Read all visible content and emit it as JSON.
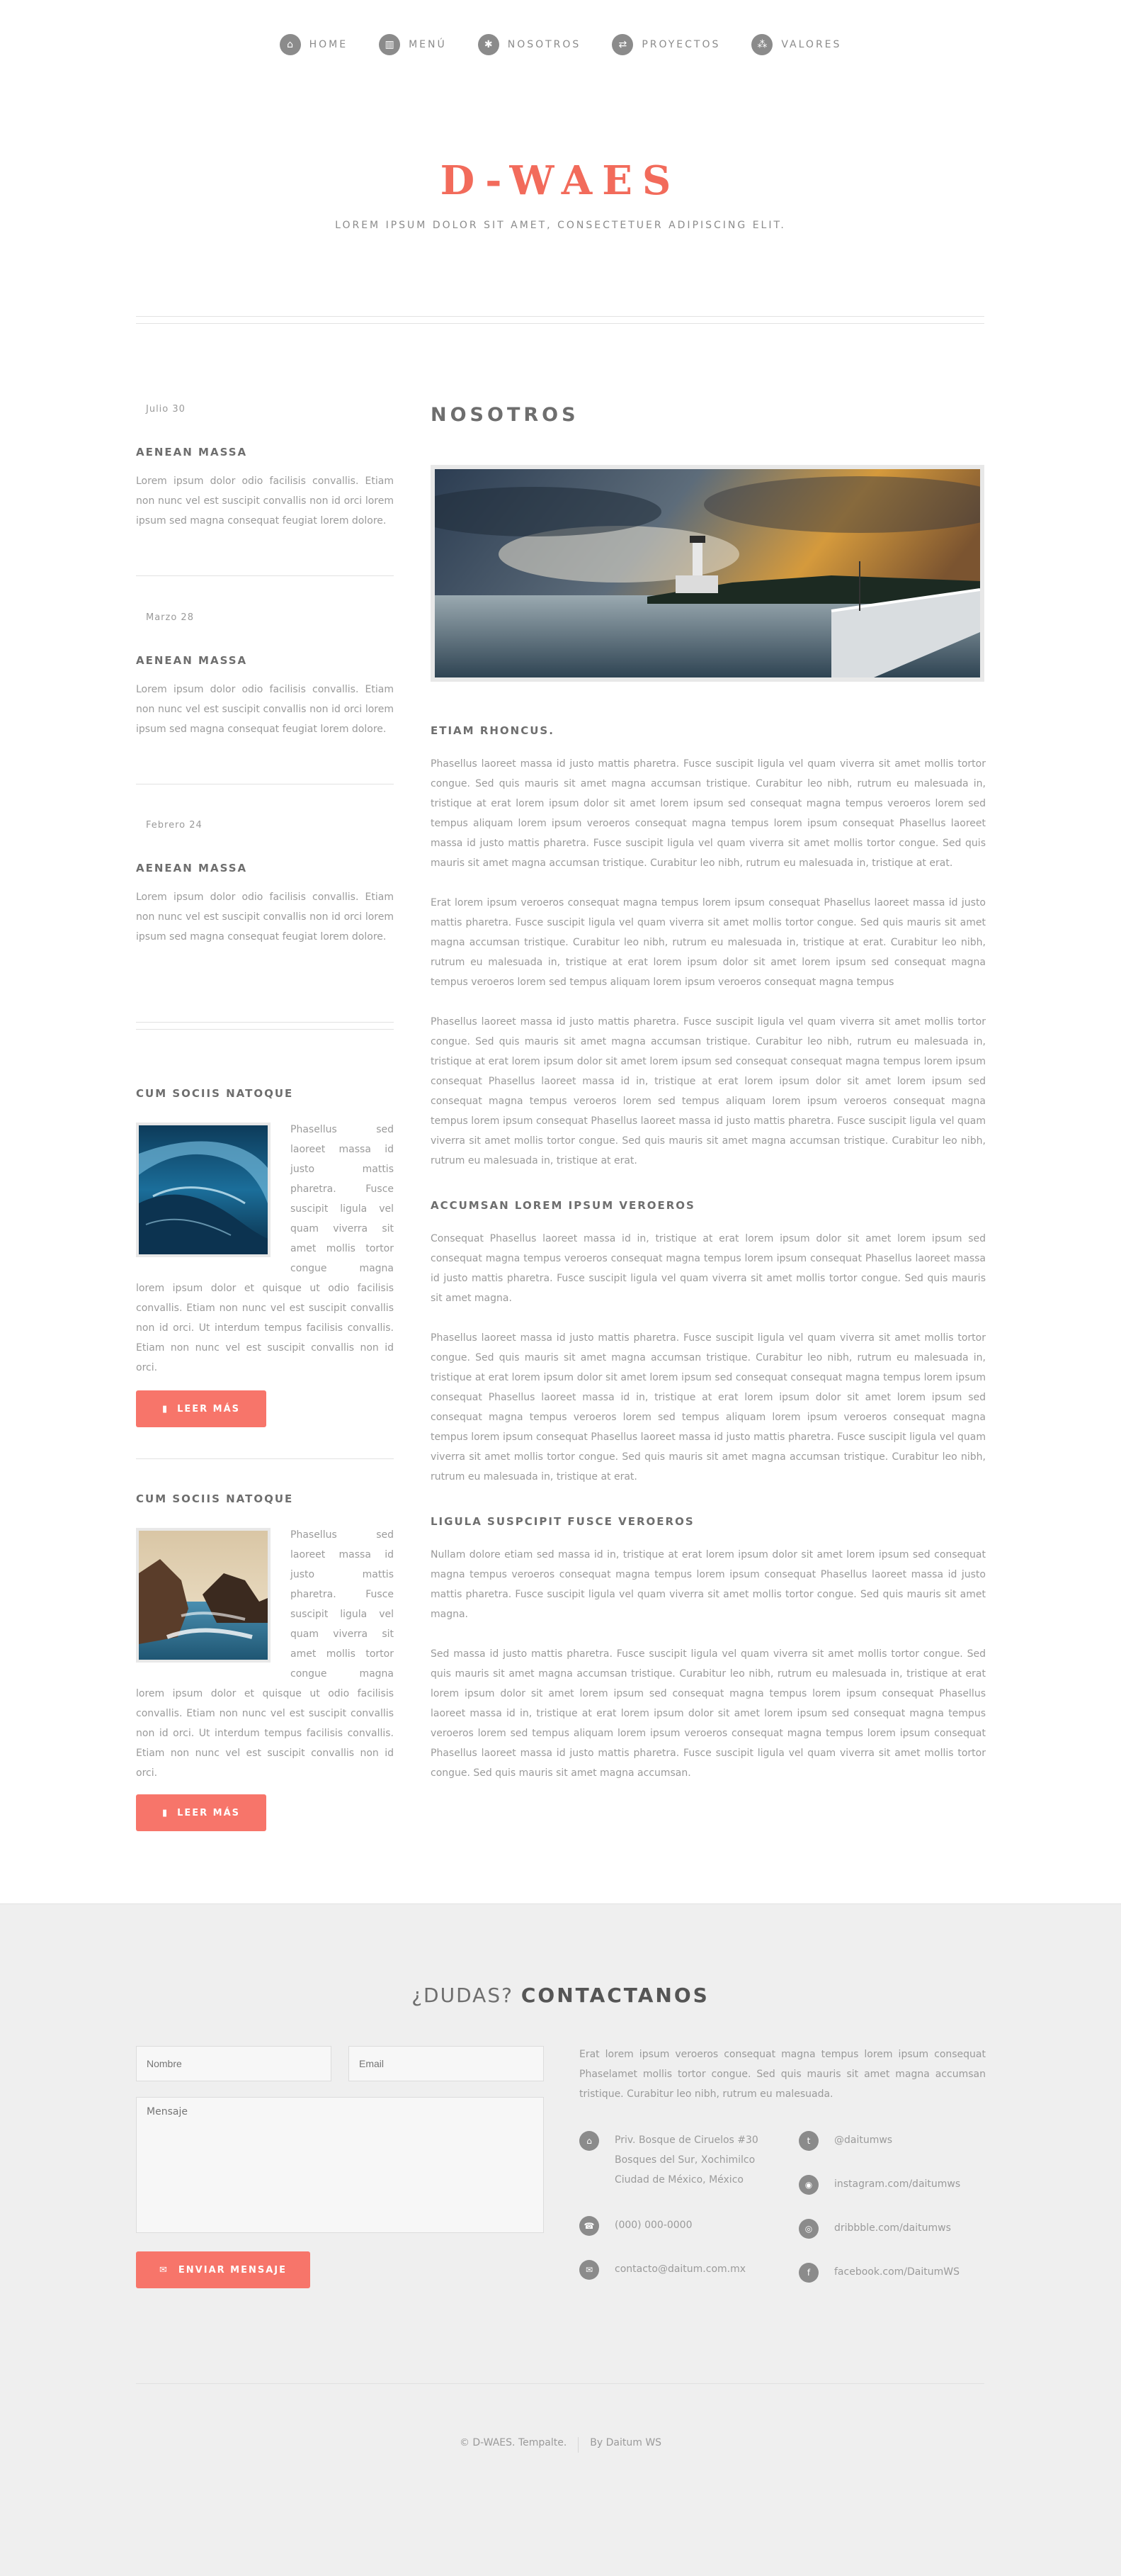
{
  "nav": [
    {
      "icon": "home-icon",
      "glyph": "⌂",
      "label": "HOME"
    },
    {
      "icon": "chart-icon",
      "glyph": "▥",
      "label": "MENÚ"
    },
    {
      "icon": "gear-icon",
      "glyph": "✱",
      "label": "NOSOTROS"
    },
    {
      "icon": "retweet-icon",
      "glyph": "⇄",
      "label": "PROYECTOS"
    },
    {
      "icon": "sitemap-icon",
      "glyph": "⁂",
      "label": "VALORES"
    }
  ],
  "header": {
    "logo": "D-WAES",
    "tagline": "LOREM IPSUM DOLOR SIT AMET, CONSECTETUER ADIPISCING ELIT."
  },
  "sidebar": {
    "posts": [
      {
        "date": "Julio 30",
        "title": "AENEAN MASSA",
        "text": "Lorem ipsum dolor odio facilisis convallis. Etiam non nunc vel est suscipit convallis non id orci lorem ipsum sed magna consequat feugiat lorem dolore."
      },
      {
        "date": "Marzo 28",
        "title": "AENEAN MASSA",
        "text": "Lorem ipsum dolor odio facilisis convallis. Etiam non nunc vel est suscipit convallis non id orci lorem ipsum sed magna consequat feugiat lorem dolore."
      },
      {
        "date": "Febrero 24",
        "title": "AENEAN MASSA",
        "text": "Lorem ipsum dolor odio facilisis convallis. Etiam non nunc vel est suscipit convallis non id orci lorem ipsum sed magna consequat feugiat lorem dolore."
      }
    ],
    "features": [
      {
        "title": "CUM SOCIIS NATOQUE",
        "text": "Phasellus sed laoreet massa id justo mattis pharetra. Fusce suscipit ligula vel quam viverra sit amet mollis tortor congue magna lorem ipsum dolor et quisque ut odio facilisis convallis. Etiam non nunc vel est suscipit convallis non id orci. Ut interdum tempus facilisis convallis. Etiam non nunc vel est suscipit convallis non id orci.",
        "button": "LEER MÁS"
      },
      {
        "title": "CUM SOCIIS NATOQUE",
        "text": "Phasellus sed laoreet massa id justo mattis pharetra. Fusce suscipit ligula vel quam viverra sit amet mollis tortor congue magna lorem ipsum dolor et quisque ut odio facilisis convallis. Etiam non nunc vel est suscipit convallis non id orci. Ut interdum tempus facilisis convallis. Etiam non nunc vel est suscipit convallis non id orci.",
        "button": "LEER MÁS"
      }
    ]
  },
  "main": {
    "heading": "NOSOTROS",
    "sections": [
      {
        "title": "ETIAM RHONCUS.",
        "paras": [
          "Phasellus laoreet massa id justo mattis pharetra. Fusce suscipit ligula vel quam viverra sit amet mollis tortor congue. Sed quis mauris sit amet magna accumsan tristique. Curabitur leo nibh, rutrum eu malesuada in, tristique at erat lorem ipsum dolor sit amet lorem ipsum sed consequat magna tempus veroeros lorem sed tempus aliquam lorem ipsum veroeros consequat magna tempus lorem ipsum consequat Phasellus laoreet massa id justo mattis pharetra. Fusce suscipit ligula vel quam viverra sit amet mollis tortor congue. Sed quis mauris sit amet magna accumsan tristique. Curabitur leo nibh, rutrum eu malesuada in, tristique at erat.",
          "Erat lorem ipsum veroeros consequat magna tempus lorem ipsum consequat Phasellus laoreet massa id justo mattis pharetra. Fusce suscipit ligula vel quam viverra sit amet mollis tortor congue. Sed quis mauris sit amet magna accumsan tristique. Curabitur leo nibh, rutrum eu malesuada in, tristique at erat. Curabitur leo nibh, rutrum eu malesuada in, tristique at erat lorem ipsum dolor sit amet lorem ipsum sed consequat magna tempus veroeros lorem sed tempus aliquam lorem ipsum veroeros consequat magna tempus",
          "Phasellus laoreet massa id justo mattis pharetra. Fusce suscipit ligula vel quam viverra sit amet mollis tortor congue. Sed quis mauris sit amet magna accumsan tristique. Curabitur leo nibh, rutrum eu malesuada in, tristique at erat lorem ipsum dolor sit amet lorem ipsum sed consequat consequat magna tempus lorem ipsum consequat Phasellus laoreet massa id in, tristique at erat lorem ipsum dolor sit amet lorem ipsum sed consequat magna tempus veroeros lorem sed tempus aliquam lorem ipsum veroeros consequat magna tempus lorem ipsum consequat Phasellus laoreet massa id justo mattis pharetra. Fusce suscipit ligula vel quam viverra sit amet mollis tortor congue. Sed quis mauris sit amet magna accumsan tristique. Curabitur leo nibh, rutrum eu malesuada in, tristique at erat."
        ]
      },
      {
        "title": "ACCUMSAN LOREM IPSUM VEROEROS",
        "paras": [
          "Consequat Phasellus laoreet massa id in, tristique at erat lorem ipsum dolor sit amet lorem ipsum sed consequat magna tempus veroeros consequat magna tempus lorem ipsum consequat Phasellus laoreet massa id justo mattis pharetra. Fusce suscipit ligula vel quam viverra sit amet mollis tortor congue. Sed quis mauris sit amet magna.",
          "Phasellus laoreet massa id justo mattis pharetra. Fusce suscipit ligula vel quam viverra sit amet mollis tortor congue. Sed quis mauris sit amet magna accumsan tristique. Curabitur leo nibh, rutrum eu malesuada in, tristique at erat lorem ipsum dolor sit amet lorem ipsum sed consequat consequat magna tempus lorem ipsum consequat Phasellus laoreet massa id in, tristique at erat lorem ipsum dolor sit amet lorem ipsum sed consequat magna tempus veroeros lorem sed tempus aliquam lorem ipsum veroeros consequat magna tempus lorem ipsum consequat Phasellus laoreet massa id justo mattis pharetra. Fusce suscipit ligula vel quam viverra sit amet mollis tortor congue. Sed quis mauris sit amet magna accumsan tristique. Curabitur leo nibh, rutrum eu malesuada in, tristique at erat."
        ]
      },
      {
        "title": "LIGULA SUSPCIPIT FUSCE VEROEROS",
        "paras": [
          "Nullam dolore etiam sed massa id in, tristique at erat lorem ipsum dolor sit amet lorem ipsum sed consequat magna tempus veroeros consequat magna tempus lorem ipsum consequat Phasellus laoreet massa id justo mattis pharetra. Fusce suscipit ligula vel quam viverra sit amet mollis tortor congue. Sed quis mauris sit amet magna.",
          "Sed massa id justo mattis pharetra. Fusce suscipit ligula vel quam viverra sit amet mollis tortor congue. Sed quis mauris sit amet magna accumsan tristique. Curabitur leo nibh, rutrum eu malesuada in, tristique at erat lorem ipsum dolor sit amet lorem ipsum sed consequat magna tempus lorem ipsum consequat Phasellus laoreet massa id in, tristique at erat lorem ipsum dolor sit amet lorem ipsum sed consequat magna tempus veroeros lorem sed tempus aliquam lorem ipsum veroeros consequat magna tempus lorem ipsum consequat Phasellus laoreet massa id justo mattis pharetra. Fusce suscipit ligula vel quam viverra sit amet mollis tortor congue. Sed quis mauris sit amet magna accumsan."
        ]
      }
    ]
  },
  "contact": {
    "heading_light": "¿DUDAS?",
    "heading_bold": "CONTACTANOS",
    "name_placeholder": "Nombre",
    "email_placeholder": "Email",
    "message_placeholder": "Mensaje",
    "send_label": "ENVIAR MENSAJE",
    "intro": "Erat lorem ipsum veroeros consequat magna tempus lorem ipsum consequat Phaselamet mollis tortor congue. Sed quis mauris sit amet magna accumsan tristique. Curabitur leo nibh, rutrum eu malesuada.",
    "address_line1": "Priv. Bosque de Ciruelos #30",
    "address_line2": "Bosques del Sur, Xochimilco",
    "address_line3": "Ciudad de México, México",
    "phone": "(000) 000-0000",
    "email": "contacto@daitum.com.mx",
    "twitter": "@daitumws",
    "instagram": "instagram.com/daitumws",
    "dribbble": "dribbble.com/daitumws",
    "facebook": "facebook.com/DaitumWS"
  },
  "copyright": {
    "left": "© D-WAES. Tempalte.",
    "right": "By Daitum WS"
  },
  "colors": {
    "accent": "#f7756a",
    "logo": "#f26b5b",
    "icon_bg": "#8b8b8b",
    "footer_bg": "#efefef"
  }
}
